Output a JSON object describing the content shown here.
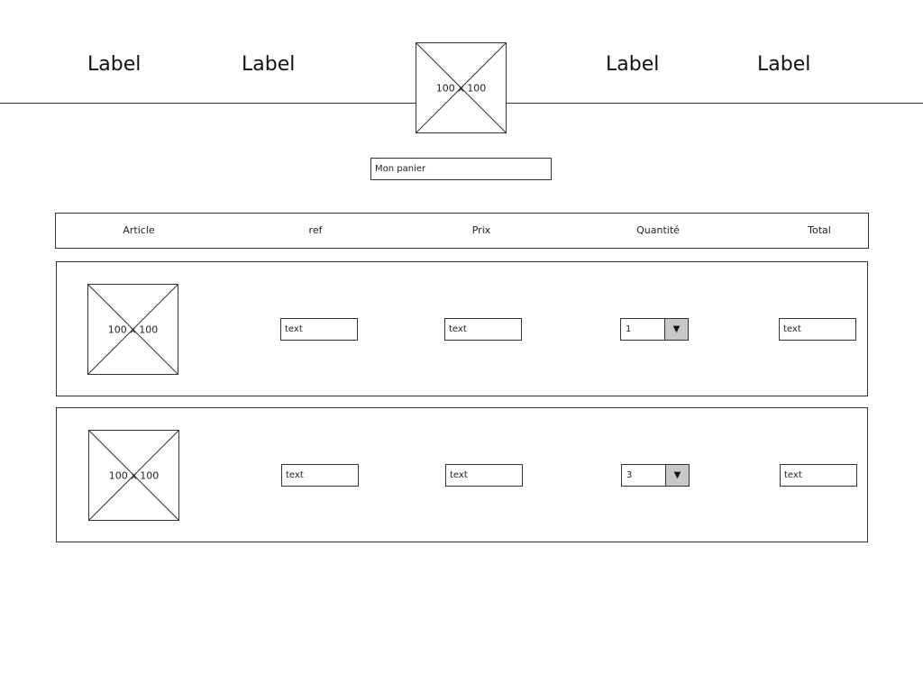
{
  "nav": {
    "items": [
      {
        "label": "Label"
      },
      {
        "label": "Label"
      },
      {
        "label": "Label"
      },
      {
        "label": "Label"
      }
    ],
    "logo_text": "100 x 100"
  },
  "cart": {
    "title": "Mon panier"
  },
  "table": {
    "headers": [
      "Article",
      "ref",
      "Prix",
      "Quantité",
      "Total"
    ],
    "rows": [
      {
        "image_text": "100 x 100",
        "ref": "text",
        "prix": "text",
        "quantite": "1",
        "total": "text"
      },
      {
        "image_text": "100 x 100",
        "ref": "text",
        "prix": "text",
        "quantite": "3",
        "total": "text"
      }
    ]
  },
  "icons": {
    "dropdown": "chevron-down-icon"
  },
  "colors": {
    "stroke": "#333333",
    "dropdown_button": "#c8c8c8"
  }
}
